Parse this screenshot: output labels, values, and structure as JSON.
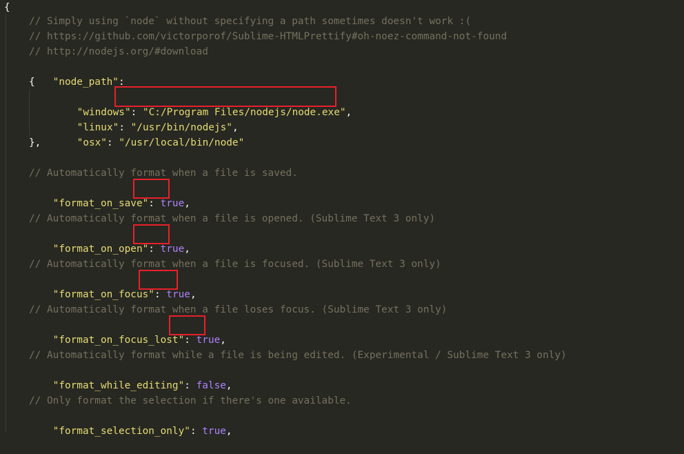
{
  "editor": {
    "colors": {
      "background": "#272822",
      "comment": "#75715e",
      "string": "#e6db74",
      "boolean": "#ae81ff",
      "text": "#f8f8f2",
      "highlight_box": "#e8202a"
    },
    "lines": [
      {
        "id": "open-brace",
        "text": "{"
      },
      {
        "id": "comment-1",
        "text": "// Simply using `node` without specifying a path sometimes doesn't work :("
      },
      {
        "id": "comment-2",
        "text": "// https://github.com/victorporof/Sublime-HTMLPrettify#oh-noez-command-not-found"
      },
      {
        "id": "comment-3",
        "text": "// http://nodejs.org/#download"
      },
      {
        "id": "node-path-key",
        "text": "\"node_path\"",
        "punct": ":"
      },
      {
        "id": "node-path-open",
        "text": "{"
      },
      {
        "id": "windows",
        "key": "\"windows\"",
        "value": "\"C:/Program Files/nodejs/node.exe\"",
        "tail": ","
      },
      {
        "id": "linux",
        "key": "\"linux\"",
        "value": "\"/usr/bin/nodejs\"",
        "tail": ","
      },
      {
        "id": "osx",
        "key": "\"osx\"",
        "value": "\"/usr/local/bin/node\"",
        "tail": ""
      },
      {
        "id": "node-path-close",
        "text": "},"
      },
      {
        "id": "comment-save",
        "text": "// Automatically format when a file is saved."
      },
      {
        "id": "format-on-save",
        "key": "\"format_on_save\"",
        "value": "true",
        "tail": ","
      },
      {
        "id": "comment-open",
        "text": "// Automatically format when a file is opened. (Sublime Text 3 only)"
      },
      {
        "id": "format-on-open",
        "key": "\"format_on_open\"",
        "value": "true",
        "tail": ","
      },
      {
        "id": "comment-focus",
        "text": "// Automatically format when a file is focused. (Sublime Text 3 only)"
      },
      {
        "id": "format-on-focus",
        "key": "\"format_on_focus\"",
        "value": "true",
        "tail": ","
      },
      {
        "id": "comment-focus-lost",
        "text": "// Automatically format when a file loses focus. (Sublime Text 3 only)"
      },
      {
        "id": "format-on-focus-lost",
        "key": "\"format_on_focus_lost\"",
        "value": "true",
        "tail": ","
      },
      {
        "id": "comment-editing",
        "text": "// Automatically format while a file is being edited. (Experimental / Sublime Text 3 only)"
      },
      {
        "id": "format-while-editing",
        "key": "\"format_while_editing\"",
        "value": "false",
        "tail": ","
      },
      {
        "id": "comment-selection",
        "text": "// Only format the selection if there's one available."
      },
      {
        "id": "format-selection-only",
        "key": "\"format_selection_only\"",
        "value": "true",
        "tail": ","
      }
    ]
  }
}
